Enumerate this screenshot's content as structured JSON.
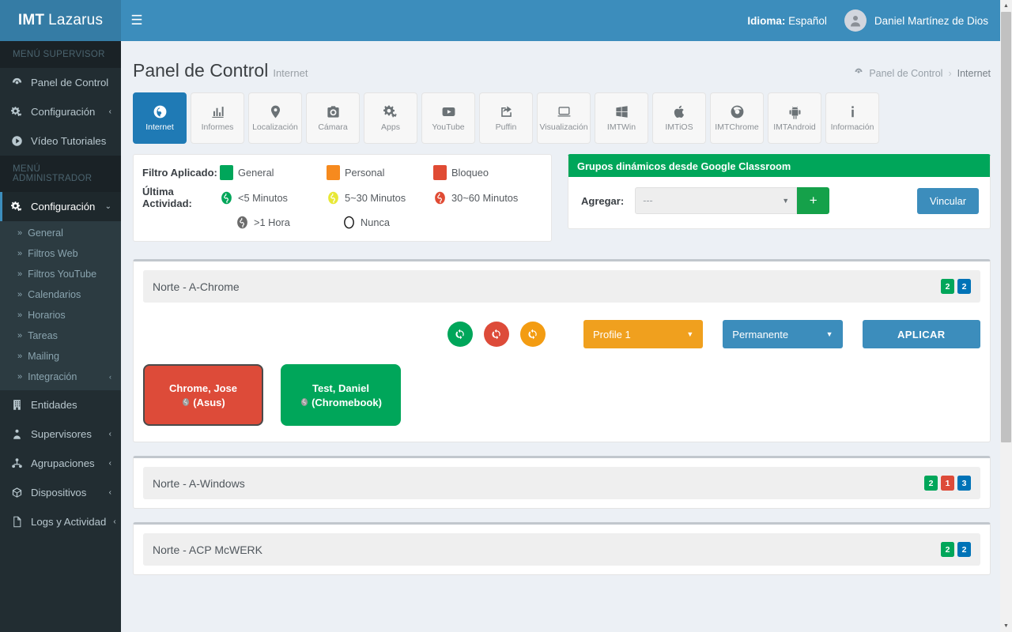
{
  "brand": {
    "bold": "IMT",
    "light": "Lazarus"
  },
  "topbar": {
    "hamburger_icon": "hamburger-icon",
    "language_label": "Idioma:",
    "language_value": "Español",
    "user_name": "Daniel Martínez de Dios",
    "avatar_icon": "user-avatar-icon"
  },
  "sidebar": {
    "supervisor_header": "MENÚ SUPERVISOR",
    "admin_header": "MENÚ ADMINISTRADOR",
    "supervisor_items": [
      {
        "label": "Panel de Control",
        "icon": "dashboard-icon",
        "arrow": ""
      },
      {
        "label": "Configuración",
        "icon": "gears-icon",
        "arrow": "‹"
      },
      {
        "label": "Vídeo Tutoriales",
        "icon": "play-circle-icon",
        "arrow": ""
      }
    ],
    "admin_item": {
      "label": "Configuración",
      "icon": "gears-icon",
      "arrow": "⌄"
    },
    "submenu": [
      {
        "label": "General",
        "arrow": ""
      },
      {
        "label": "Filtros Web",
        "arrow": ""
      },
      {
        "label": "Filtros YouTube",
        "arrow": ""
      },
      {
        "label": "Calendarios",
        "arrow": ""
      },
      {
        "label": "Horarios",
        "arrow": ""
      },
      {
        "label": "Tareas",
        "arrow": ""
      },
      {
        "label": "Mailing",
        "arrow": ""
      },
      {
        "label": "Integración",
        "arrow": "‹"
      }
    ],
    "admin_items": [
      {
        "label": "Entidades",
        "icon": "building-icon",
        "arrow": ""
      },
      {
        "label": "Supervisores",
        "icon": "supervisor-icon",
        "arrow": "‹"
      },
      {
        "label": "Agrupaciones",
        "icon": "sitemap-icon",
        "arrow": "‹"
      },
      {
        "label": "Dispositivos",
        "icon": "cube-icon",
        "arrow": "‹"
      },
      {
        "label": "Logs y Actividad",
        "icon": "file-icon",
        "arrow": "‹"
      }
    ]
  },
  "page": {
    "title": "Panel de Control",
    "subtitle": "Internet",
    "breadcrumb_icon": "dashboard-icon",
    "breadcrumb_root": "Panel de Control",
    "breadcrumb_sep": "›",
    "breadcrumb_current": "Internet"
  },
  "tabs": [
    {
      "label": "Internet",
      "icon": "globe-icon",
      "active": true
    },
    {
      "label": "Informes",
      "icon": "bar-chart-icon",
      "active": false
    },
    {
      "label": "Localización",
      "icon": "map-marker-icon",
      "active": false
    },
    {
      "label": "Cámara",
      "icon": "camera-icon",
      "active": false
    },
    {
      "label": "Apps",
      "icon": "gears-icon",
      "active": false
    },
    {
      "label": "YouTube",
      "icon": "youtube-icon",
      "active": false
    },
    {
      "label": "Puffin",
      "icon": "share-square-icon",
      "active": false
    },
    {
      "label": "Visualización",
      "icon": "laptop-icon",
      "active": false
    },
    {
      "label": "IMTWin",
      "icon": "windows-icon",
      "active": false
    },
    {
      "label": "IMTiOS",
      "icon": "apple-icon",
      "active": false
    },
    {
      "label": "IMTChrome",
      "icon": "chrome-icon",
      "active": false
    },
    {
      "label": "IMTAndroid",
      "icon": "android-icon",
      "active": false
    },
    {
      "label": "Información",
      "icon": "info-icon",
      "active": false
    }
  ],
  "legend": {
    "filter_label": "Filtro Aplicado:",
    "activity_label": "Última Actividad:",
    "filters": [
      {
        "label": "General",
        "color": "#00a65a"
      },
      {
        "label": "Personal",
        "color": "#f68a1e"
      },
      {
        "label": "Bloqueo",
        "color": "#e04b34"
      }
    ],
    "activity_row1": [
      {
        "label": "<5 Minutos",
        "color": "#00a65a"
      },
      {
        "label": "5~30 Minutos",
        "color": "#e8e836"
      },
      {
        "label": "30~60 Minutos",
        "color": "#e04b34"
      }
    ],
    "activity_row2": [
      {
        "label": ">1 Hora",
        "color": "#6b6b6b"
      },
      {
        "label": "Nunca",
        "color": "#ffffff"
      }
    ]
  },
  "classroom": {
    "title": "Grupos dinámicos desde Google Classroom",
    "add_label": "Agregar:",
    "select_value": "---",
    "select_caret": "▼",
    "plus_label": "+",
    "link_button": "Vincular"
  },
  "groups": [
    {
      "name": "Norte - A-Chrome",
      "badges": [
        {
          "value": "2",
          "color": "green"
        },
        {
          "value": "2",
          "color": "blue"
        }
      ],
      "expanded": true,
      "controls": {
        "refresh_green": "refresh-icon",
        "refresh_red": "refresh-icon",
        "refresh_orange": "refresh-icon",
        "profile_value": "Profile 1",
        "duration_value": "Permanente",
        "apply_label": "APLICAR",
        "caret": "▼"
      },
      "devices": [
        {
          "name": "Chrome, Jose",
          "sub": "(Asus)",
          "color": "red",
          "selected": true
        },
        {
          "name": "Test, Daniel",
          "sub": "(Chromebook)",
          "color": "green",
          "selected": false
        }
      ]
    },
    {
      "name": "Norte - A-Windows",
      "badges": [
        {
          "value": "2",
          "color": "green"
        },
        {
          "value": "1",
          "color": "red"
        },
        {
          "value": "3",
          "color": "blue"
        }
      ],
      "expanded": false,
      "devices": []
    },
    {
      "name": "Norte - ACP McWERK",
      "badges": [
        {
          "value": "2",
          "color": "green"
        },
        {
          "value": "2",
          "color": "blue"
        }
      ],
      "expanded": false,
      "devices": []
    }
  ],
  "scrollbar": {
    "up_icon": "scroll-up-icon",
    "down_icon": "scroll-down-icon"
  },
  "colors": {
    "brand_header": "#3c8dbc",
    "brand_logo": "#357ca5",
    "sidebar": "#222d32",
    "accent_green": "#00a65a",
    "accent_red": "#dd4b39",
    "accent_orange": "#f39c12",
    "accent_blue": "#0073b7",
    "page_bg": "#ecf0f5"
  }
}
